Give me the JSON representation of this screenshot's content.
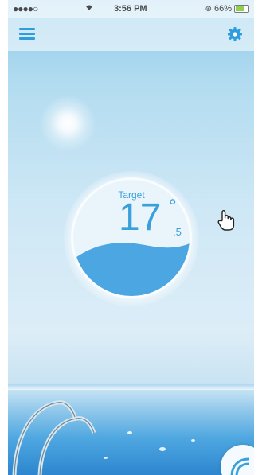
{
  "status_bar": {
    "signal": "●●●●○",
    "time": "3:56 PM",
    "battery": "66%"
  },
  "nav": {
    "menu_icon": "hamburger-menu-icon",
    "settings_icon": "gear-icon"
  },
  "thermostat": {
    "label": "Target",
    "temperature_integer": "17",
    "degree_symbol": "°",
    "temperature_decimal": ".5"
  },
  "colors": {
    "accent": "#2d9de0",
    "water": "#4ba6e2",
    "background": "#d2e9f6"
  }
}
